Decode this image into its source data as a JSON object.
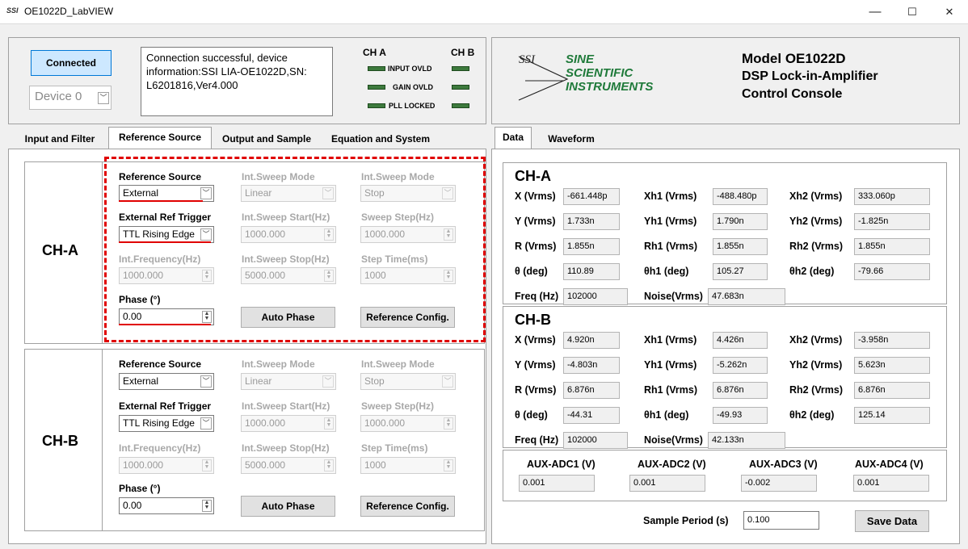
{
  "window": {
    "icon": "SSI",
    "title": "OE1022D_LabVIEW",
    "min": "—",
    "max": "☐",
    "close": "✕"
  },
  "connection": {
    "button": "Connected",
    "device": "Device 0",
    "message": "Connection successful, device information:SSI LIA-OE1022D,SN: L6201816,Ver4.000"
  },
  "indicators": {
    "cha": "CH A",
    "chb": "CH B",
    "rows": [
      "INPUT OVLD",
      "GAIN OVLD",
      "PLL LOCKED"
    ]
  },
  "logo": {
    "badge": "SSI",
    "line1": "SINE",
    "line2": "SCIENTIFIC",
    "line3": "INSTRUMENTS"
  },
  "model": {
    "line1": "Model OE1022D",
    "line2": "DSP Lock-in-Amplifier",
    "line3": "Control Console"
  },
  "left_tabs": [
    "Input and Filter",
    "Reference Source",
    "Output and Sample",
    "Equation and System"
  ],
  "right_tabs": [
    "Data",
    "Waveform"
  ],
  "ref": {
    "labels": {
      "ref_source": "Reference Source",
      "sweep_mode": "Int.Sweep Mode",
      "ext_trigger": "External Ref Trigger",
      "sweep_start": "Int.Sweep Start(Hz)",
      "sweep_step": "Sweep Step(Hz)",
      "int_freq": "Int.Frequency(Hz)",
      "sweep_stop": "Int.Sweep Stop(Hz)",
      "step_time": "Step Time(ms)",
      "phase": "Phase (°)"
    },
    "buttons": {
      "auto_phase": "Auto Phase",
      "ref_config": "Reference Config."
    },
    "cha": {
      "name": "CH-A",
      "ref_source": "External",
      "sweep_mode": "Linear",
      "sweep_mode2": "Stop",
      "ext_trigger": "TTL Rising Edge",
      "sweep_start": "1000.000",
      "sweep_step": "1000.000",
      "int_freq": "1000.000",
      "sweep_stop": "5000.000",
      "step_time": "1000",
      "phase": "0.00"
    },
    "chb": {
      "name": "CH-B",
      "ref_source": "External",
      "sweep_mode": "Linear",
      "sweep_mode2": "Stop",
      "ext_trigger": "TTL Rising Edge",
      "sweep_start": "1000.000",
      "sweep_step": "1000.000",
      "int_freq": "1000.000",
      "sweep_stop": "5000.000",
      "step_time": "1000",
      "phase": "0.00"
    }
  },
  "data": {
    "cha": {
      "title": "CH-A",
      "rows": [
        [
          {
            "label": "X (Vrms)",
            "value": "-661.448p"
          },
          {
            "label": "Xh1 (Vrms)",
            "value": "-488.480p"
          },
          {
            "label": "Xh2 (Vrms)",
            "value": "333.060p"
          }
        ],
        [
          {
            "label": "Y (Vrms)",
            "value": "1.733n"
          },
          {
            "label": "Yh1 (Vrms)",
            "value": "1.790n"
          },
          {
            "label": "Yh2 (Vrms)",
            "value": "-1.825n"
          }
        ],
        [
          {
            "label": "R (Vrms)",
            "value": "1.855n"
          },
          {
            "label": "Rh1 (Vrms)",
            "value": "1.855n"
          },
          {
            "label": "Rh2 (Vrms)",
            "value": "1.855n"
          }
        ],
        [
          {
            "label": "θ  (deg)",
            "value": "110.89"
          },
          {
            "label": "θh1  (deg)",
            "value": "105.27"
          },
          {
            "label": "θh2  (deg)",
            "value": "-79.66"
          }
        ],
        [
          {
            "label": "Freq (Hz)",
            "value": "102000"
          },
          {
            "label": "Noise(Vrms)",
            "value": "47.683n"
          }
        ]
      ]
    },
    "chb": {
      "title": "CH-B",
      "rows": [
        [
          {
            "label": "X (Vrms)",
            "value": "4.920n"
          },
          {
            "label": "Xh1 (Vrms)",
            "value": "4.426n"
          },
          {
            "label": "Xh2 (Vrms)",
            "value": "-3.958n"
          }
        ],
        [
          {
            "label": "Y (Vrms)",
            "value": "-4.803n"
          },
          {
            "label": "Yh1 (Vrms)",
            "value": "-5.262n"
          },
          {
            "label": "Yh2 (Vrms)",
            "value": "5.623n"
          }
        ],
        [
          {
            "label": "R (Vrms)",
            "value": "6.876n"
          },
          {
            "label": "Rh1 (Vrms)",
            "value": "6.876n"
          },
          {
            "label": "Rh2 (Vrms)",
            "value": "6.876n"
          }
        ],
        [
          {
            "label": "θ  (deg)",
            "value": "-44.31"
          },
          {
            "label": "θh1  (deg)",
            "value": "-49.93"
          },
          {
            "label": "θh2  (deg)",
            "value": "125.14"
          }
        ],
        [
          {
            "label": "Freq (Hz)",
            "value": "102000"
          },
          {
            "label": "Noise(Vrms)",
            "value": "42.133n"
          }
        ]
      ]
    },
    "aux": [
      {
        "label": "AUX-ADC1 (V)",
        "value": "0.001"
      },
      {
        "label": "AUX-ADC2 (V)",
        "value": "0.001"
      },
      {
        "label": "AUX-ADC3 (V)",
        "value": "-0.002"
      },
      {
        "label": "AUX-ADC4 (V)",
        "value": "0.001"
      }
    ],
    "sample_period_label": "Sample Period (s)",
    "sample_period": "0.100",
    "save": "Save Data"
  },
  "colors": {
    "accent": "#cde8ff",
    "highlight": "#e00000",
    "led": "#3d7a3d",
    "logo": "#1f7a3a"
  }
}
